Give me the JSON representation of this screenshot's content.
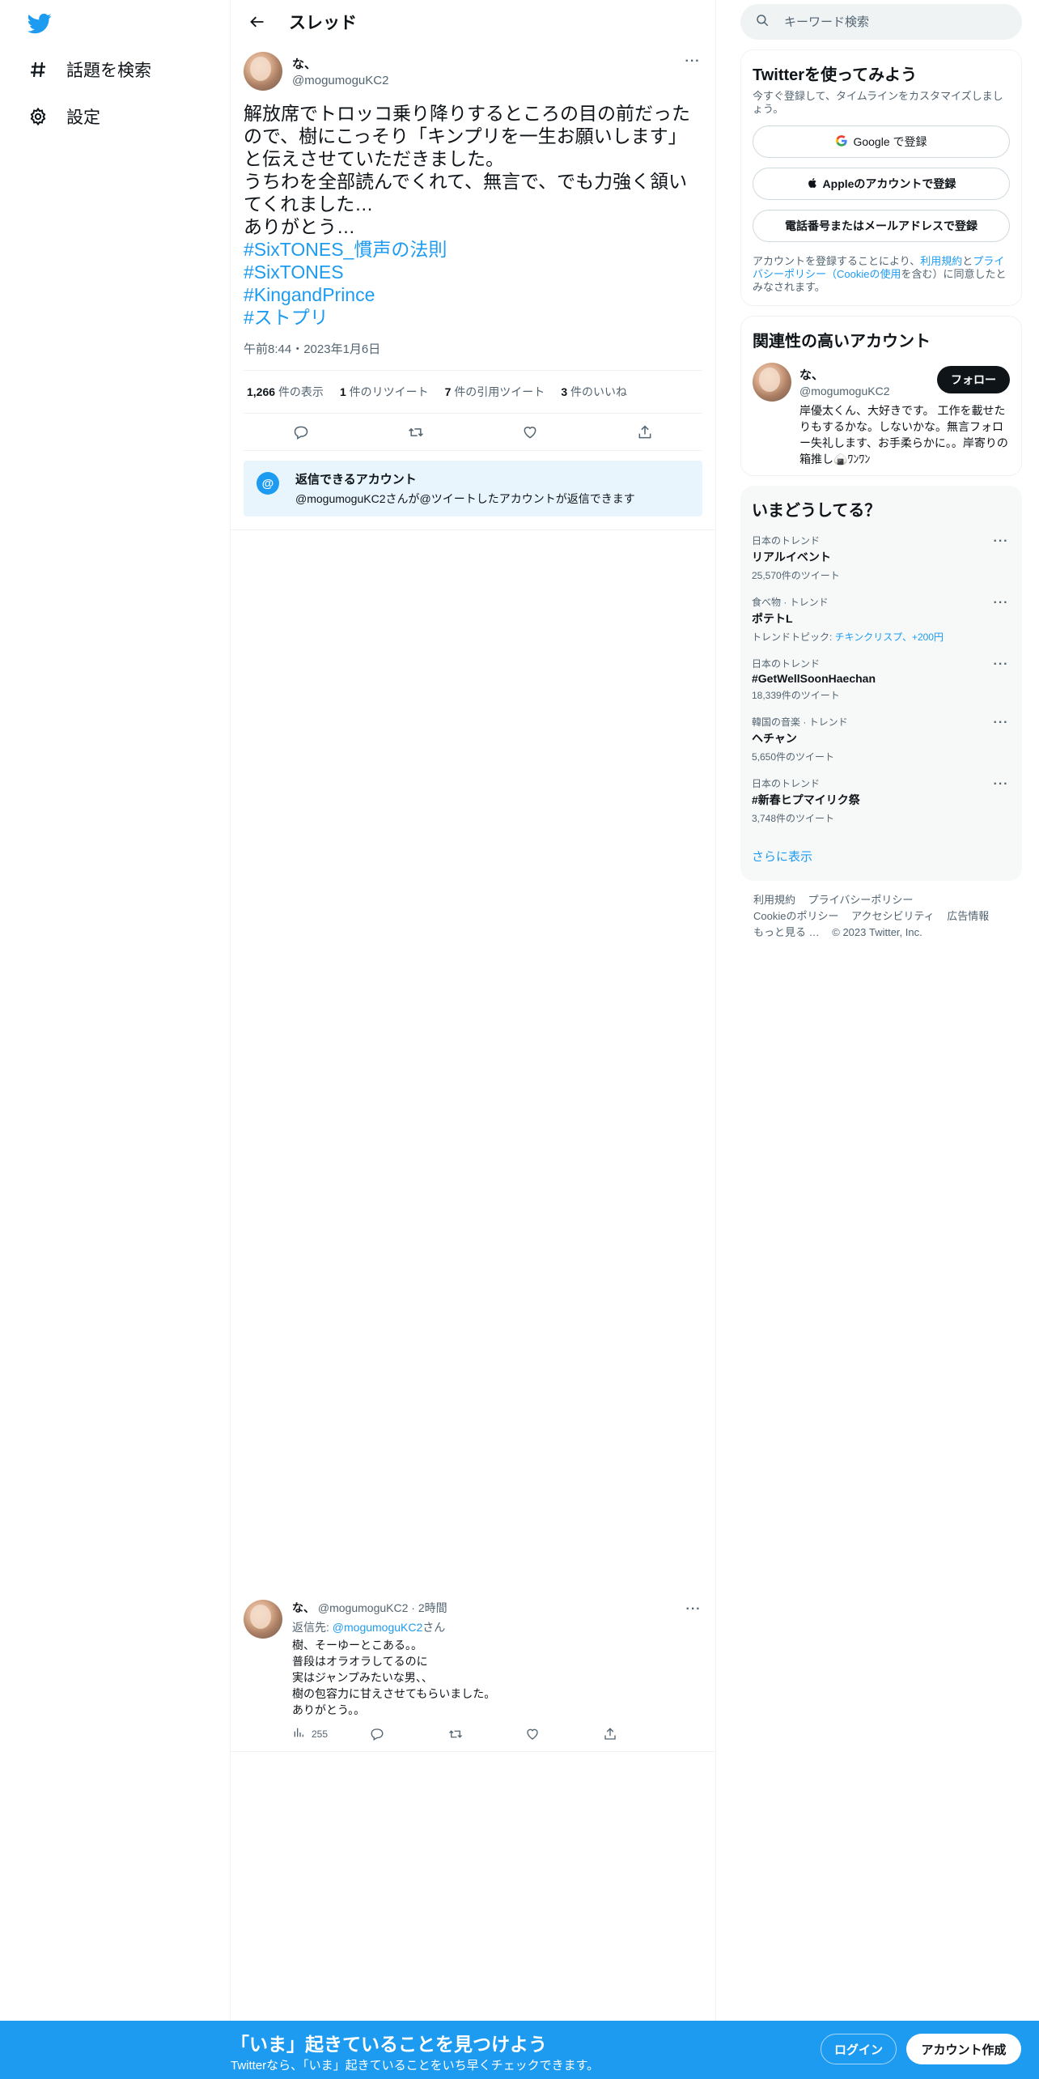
{
  "nav": {
    "logo_icon": "twitter-bird-icon",
    "items": [
      {
        "label": "話題を検索",
        "icon": "hashtag-icon"
      },
      {
        "label": "設定",
        "icon": "gear-icon"
      }
    ]
  },
  "header": {
    "title": "スレッド",
    "back_icon": "back-arrow-icon"
  },
  "tweet": {
    "name": "な、",
    "handle": "@mogumoguKC2",
    "text": "解放席でトロッコ乗り降りするところの目の前だったので、樹にこっそり「キンプリを一生お願いします」と伝えさせていただきました。\nうちわを全部読んでくれて、無言で、でも力強く頷いてくれました…\nありがとう…",
    "hashtags": [
      "#SixTONES_慣声の法則",
      "#SixTONES",
      "#KingandPrince",
      "#ストプリ"
    ],
    "time": "午前8:44・2023年1月6日",
    "stats": {
      "views_count": "1,266",
      "views_label": "件の表示",
      "retweets_count": "1",
      "retweets_label": "件のリツイート",
      "quotes_count": "7",
      "quotes_label": "件の引用ツイート",
      "likes_count": "3",
      "likes_label": "件のいいね"
    }
  },
  "reply_notice": {
    "title": "返信できるアカウント",
    "subtitle": "@mogumoguKC2さんが@ツイートしたアカウントが返信できます",
    "icon_text": "@"
  },
  "reply_tweet": {
    "name": "な、",
    "handle": "@mogumoguKC2",
    "time": "2時間",
    "reply_to_label": "返信先:",
    "reply_to_handle": "@mogumoguKC2",
    "reply_to_suffix": "さん",
    "text": "樹、そーゆーとこある。。\n普段はオラオラしてるのに\n実はジャンプみたいな男、、\n樹の包容力に甘えさせてもらいました。\nありがとう。。",
    "views": "255"
  },
  "search": {
    "placeholder": "キーワード検索"
  },
  "signup": {
    "title": "Twitterを使ってみよう",
    "subtitle": "今すぐ登録して、タイムラインをカスタマイズしましょう。",
    "google": "Google で登録",
    "apple": "Appleのアカウントで登録",
    "phone": "電話番号またはメールアドレスで登録",
    "legal_prefix": "アカウントを登録することにより、",
    "legal_link1": "利用規約",
    "legal_mid": "と",
    "legal_link2": "プライバシーポリシー（Cookieの使用",
    "legal_suffix": "を含む）に同意したとみなされます。"
  },
  "related": {
    "title": "関連性の高いアカウント",
    "name": "な、",
    "handle": "@mogumoguKC2",
    "bio": "岸優太くん、大好きです。 工作を載せたりもするかな。しないかな。無言フォロー失礼します、お手柔らかに。。岸寄りの箱推し🍙ﾜﾝﾜﾝ",
    "follow": "フォロー"
  },
  "trends": {
    "title": "いまどうしてる？",
    "items": [
      {
        "context": "日本のトレンド",
        "name": "リアルイベント",
        "count": "25,570件のツイート"
      },
      {
        "context": "食べ物 · トレンド",
        "name": "ポテトL",
        "count_prefix": "トレンドトピック: ",
        "count_link": "チキンクリスプ、+200円"
      },
      {
        "context": "日本のトレンド",
        "name": "#GetWellSoonHaechan",
        "count": "18,339件のツイート"
      },
      {
        "context": "韓国の音楽 · トレンド",
        "name": "ヘチャン",
        "count": "5,650件のツイート"
      },
      {
        "context": "日本のトレンド",
        "name": "#新春ヒプマイリク祭",
        "count": "3,748件のツイート"
      }
    ],
    "show_more": "さらに表示"
  },
  "footer": {
    "terms": "利用規約",
    "privacy": "プライバシーポリシー",
    "cookies": "Cookieのポリシー",
    "accessibility": "アクセシビリティ",
    "ads": "広告情報",
    "more": "もっと見る …",
    "copyright": "© 2023 Twitter, Inc."
  },
  "bottom_bar": {
    "title": "「いま」起きていることを見つけよう",
    "subtitle": "Twitterなら、「いま」起きていることをいち早くチェックできます。",
    "login": "ログイン",
    "signup": "アカウント作成"
  },
  "colors": {
    "accent": "#1d9bf0",
    "text": "#0f1419",
    "muted": "#536471",
    "border": "#eff3f4"
  }
}
